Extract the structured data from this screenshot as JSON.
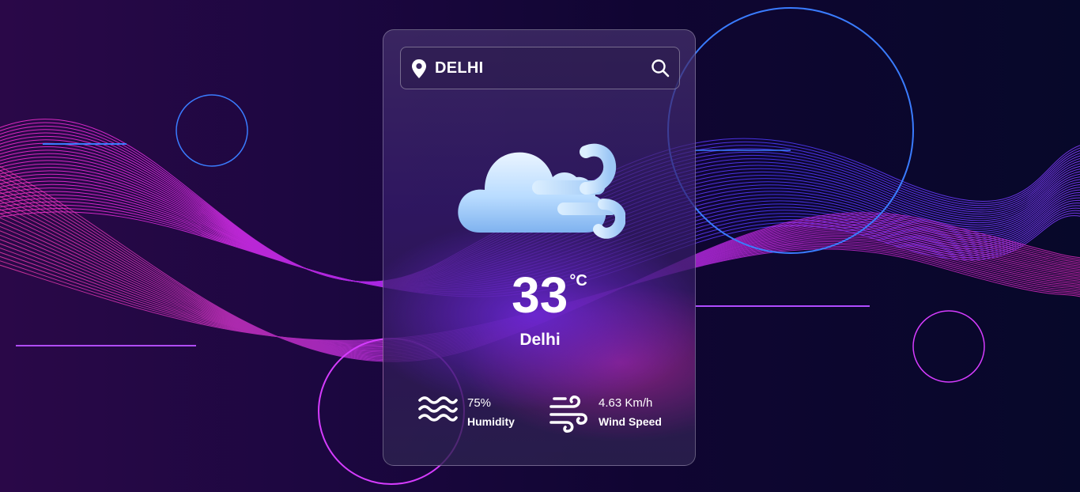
{
  "search": {
    "value": "DELHI",
    "pin_icon": "location-pin-icon",
    "search_icon": "search-icon"
  },
  "weather": {
    "condition_icon": "windy-cloud-icon",
    "temperature": "33",
    "unit": "°C",
    "city": "Delhi"
  },
  "details": {
    "humidity": {
      "icon": "waves-icon",
      "value": "75%",
      "label": "Humidity"
    },
    "wind": {
      "icon": "wind-icon",
      "value": "4.63 Km/h",
      "label": "Wind Speed"
    }
  },
  "colors": {
    "background_dark": "#100532",
    "wave_pink": "#ff2fd0",
    "wave_blue": "#3a3aff",
    "text": "#ffffff"
  }
}
